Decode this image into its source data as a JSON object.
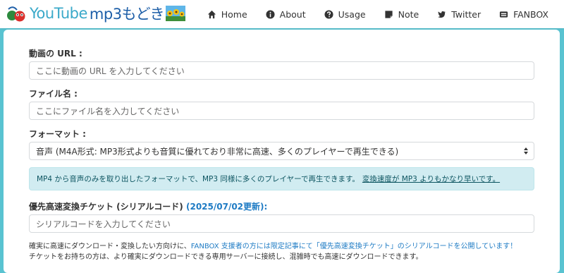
{
  "header": {
    "brand_part1": "YouTube",
    "brand_part2": "mp3もどき",
    "nav": [
      {
        "label": "Home",
        "icon": "home-icon"
      },
      {
        "label": "About",
        "icon": "info-circle-icon"
      },
      {
        "label": "Usage",
        "icon": "question-circle-icon"
      },
      {
        "label": "Note",
        "icon": "note-icon"
      },
      {
        "label": "Twitter",
        "icon": "twitter-icon"
      },
      {
        "label": "FANBOX",
        "icon": "fanbox-icon"
      }
    ]
  },
  "form": {
    "url_label": "動画の URL :",
    "url_placeholder": "ここに動画の URL を入力してください",
    "filename_label": "ファイル名 :",
    "filename_placeholder": "ここにファイル名を入力してください",
    "format_label": "フォーマット :",
    "format_selected": "音声 (M4A形式: MP3形式よりも音質に優れており非常に高速、多くのプレイヤーで再生できる)",
    "format_info": "MP4 から音声のみを取り出したフォーマットで、MP3 同様に多くのプレイヤーで再生できます。",
    "format_info_link": "変換速度が MP3 よりもかなり早いです。",
    "ticket_label": "優先高速変換チケット (シリアルコード)",
    "ticket_date": "(2025/07/02更新):",
    "ticket_placeholder": "シリアルコードを入力してください",
    "note_line1_a": "確実に高速にダウンロード・変換したい方向けに、",
    "note_line1_b": "FANBOX 支援者の方には限定記事にて「優先高速変換チケット」のシリアルコードを公開しています！",
    "note_line2": "チケットをお持ちの方は、より確実にダウンロードできる専用サーバーに接続し、混雑時でも高速にダウンロードできます。"
  },
  "colors": {
    "background": "#59c3d1",
    "accent": "#1e7bc4",
    "info_bg": "#d1ecf1",
    "info_text": "#0c5460"
  }
}
